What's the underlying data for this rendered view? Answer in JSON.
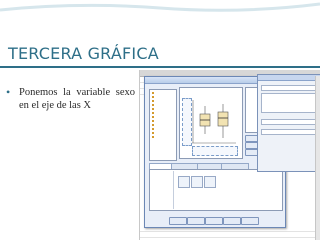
{
  "slide": {
    "title": "TERCERA GRÁFICA",
    "bullet_text": "Ponemos la variable sexo en el eje de las X"
  },
  "colors": {
    "title": "#2e6f88",
    "dialog_bg": "#e8eef8",
    "dialog_border": "#6b87b5",
    "decor": "#7fa9ba"
  },
  "icons": {
    "bullet": "bullet-icon",
    "close": "close-icon",
    "boxplot": "boxplot-icon",
    "variable": "variable-icon"
  },
  "spss": {
    "grid_headers": [
      "",
      "",
      "",
      "",
      "",
      "",
      "",
      "",
      ""
    ],
    "dialog_title": "",
    "tabs": [
      "",
      "",
      "",
      ""
    ],
    "buttons": [
      "",
      "",
      "",
      "",
      ""
    ],
    "props_title": ""
  }
}
